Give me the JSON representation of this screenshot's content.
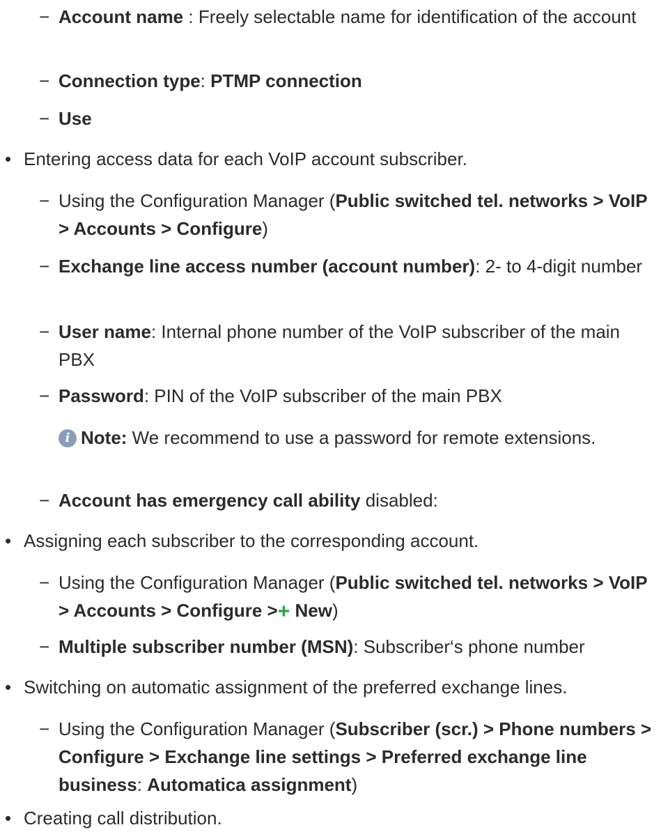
{
  "items": {
    "account_name": {
      "label": "Account name",
      "text": " : Freely selectable name for identification of the account"
    },
    "connection_type": {
      "label": "Connection type",
      "sep": ": ",
      "value": "PTMP connection"
    },
    "use": {
      "label": "Use"
    },
    "bullet1": {
      "text": "Entering access data for each VoIP account subscriber."
    },
    "cm1": {
      "pre": "Using the Configuration Manager (",
      "path": "Public switched tel. networks > VoIP > Accounts > Configure",
      "post": ")"
    },
    "exchange": {
      "label": "Exchange line access number (account number)",
      "text": ": 2- to 4-digit number"
    },
    "username": {
      "label": "User name",
      "text": ": Internal phone number of the VoIP subscriber of the main PBX"
    },
    "password": {
      "label": "Password",
      "text": ": PIN of the VoIP subscriber of the main PBX"
    },
    "note": {
      "label": "Note:",
      "text": " We recommend to use a password for remote extensions."
    },
    "emergency": {
      "label": "Account has emergency call ability",
      "text": " disabled:"
    },
    "bullet2": {
      "text": "Assigning each subscriber to the corresponding account."
    },
    "cm2": {
      "pre": "Using the Configuration Manager (",
      "path": "Public switched tel. networks > VoIP > Accounts > Configure >",
      "new": " New",
      "post": ")"
    },
    "msn": {
      "label": "Multiple subscriber number (MSN)",
      "text": ": Subscriber‘s phone number"
    },
    "bullet3": {
      "text": "Switching on automatic assignment of the preferred exchange lines."
    },
    "cm3": {
      "pre": "Using the Configuration Manager (",
      "path": "Subscriber (scr.) > Phone numbers > Configure > Exchange line settings > Preferred exchange line business",
      "sep": ": ",
      "value": "Automatica assignment",
      "post": ")"
    },
    "bullet4": {
      "text": "Creating call distribution."
    }
  },
  "icons": {
    "note": "info-icon",
    "new": "plus-icon"
  },
  "colors": {
    "text": "#2b2b2b",
    "info_icon": "#8a9db8",
    "plus": "#2ea043"
  }
}
